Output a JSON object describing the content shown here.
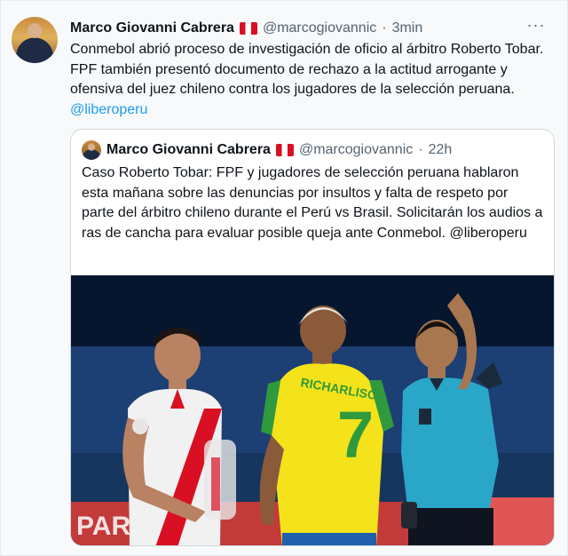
{
  "tweet": {
    "author_name": "Marco Giovanni Cabrera",
    "handle": "@marcogiovannic",
    "separator": "·",
    "time": "3min",
    "more_label": "···",
    "text": "Conmebol abrió proceso de investigación de oficio al árbitro Roberto Tobar. FPF también presentó documento de rechazo a la actitud arrogante y ofensiva del juez chileno contra los jugadores de la selección peruana.",
    "mention": "@liberoperu"
  },
  "quoted": {
    "author_name": "Marco Giovanni Cabrera",
    "handle": "@marcogiovannic",
    "separator": "·",
    "time": "22h",
    "text": "Caso Roberto Tobar: FPF y jugadores de selección peruana hablaron esta mañana sobre las denuncias por insultos y falta de respeto por parte del árbitro chileno durante el Perú vs Brasil. Solicitarán los audios a ras de cancha para evaluar posible queja ante Conmebol. @liberoperu",
    "photo_alt": "Photo of a referee, a Brazil player and a Peru player on the pitch"
  },
  "photo_texts": {
    "jersey_name": "RICHARLISON",
    "jersey_number": "7",
    "board_text": "PARA"
  },
  "colors": {
    "accent": "#1d9bf0",
    "peru_red": "#d91023",
    "brazil_yellow": "#f4e21a",
    "referee_cyan": "#2aa6c9"
  }
}
